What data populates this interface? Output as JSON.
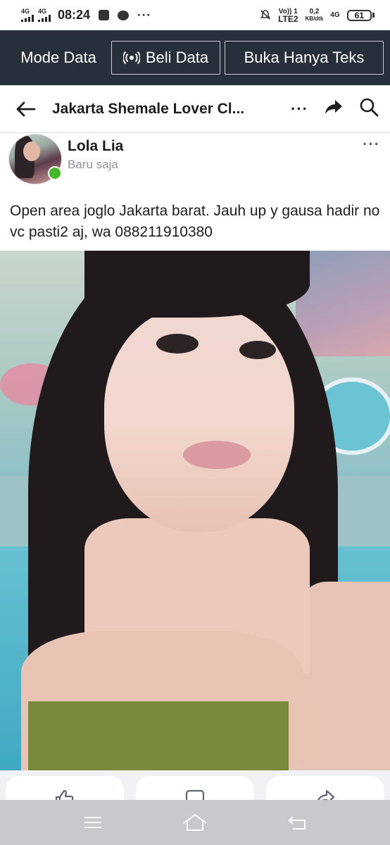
{
  "status_bar": {
    "sim1": "4G",
    "sim2": "4G",
    "time": "08:24",
    "more": "···",
    "volte": "Vo)) 1",
    "lte": "LTE2",
    "speed_value": "0,2",
    "speed_unit": "KB/dtk",
    "network": "4G",
    "battery": "61"
  },
  "data_bar": {
    "mode_label": "Mode Data",
    "buy_label": "Beli Data",
    "text_only_label": "Buka Hanya Teks"
  },
  "nav": {
    "title": "Jakarta Shemale Lover Cl...",
    "more": "···"
  },
  "post": {
    "author": "Lola Lia",
    "time": "Baru saja",
    "more": "···",
    "text": "Open area joglo Jakarta barat. Jauh up y gausa hadir no vc pasti2 aj, wa 088211910380"
  },
  "icons": {
    "back": "arrow-left-icon",
    "share": "share-arrow-icon",
    "search": "search-icon",
    "like": "thumbs-up-icon",
    "comment": "comment-icon",
    "forward": "share-icon",
    "menu": "menu-icon",
    "home": "home-icon",
    "return": "back-return-icon"
  },
  "colors": {
    "data_bar_bg": "#272f3a",
    "online": "#42b72a",
    "system_nav": "#c7c9cc"
  }
}
